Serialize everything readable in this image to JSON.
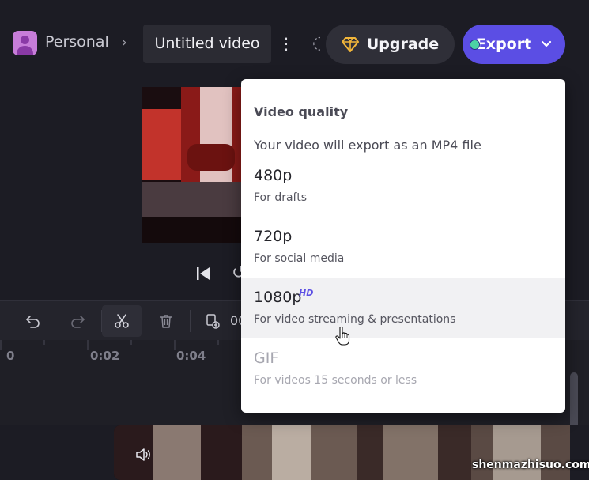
{
  "header": {
    "workspace_name": "Personal",
    "video_title": "Untitled video",
    "more_glyph": "⋮",
    "upgrade_label": "Upgrade",
    "export_label": "Export"
  },
  "timeline": {
    "time_readout_partial": "00",
    "ruler_labels": [
      "0",
      "0:02",
      "0:04"
    ]
  },
  "export_menu": {
    "heading": "Video quality",
    "subheading": "Your video will export as an MP4 file",
    "options": [
      {
        "label": "480p",
        "description": "For drafts",
        "badge": "",
        "state": "normal"
      },
      {
        "label": "720p",
        "description": "For social media",
        "badge": "",
        "state": "normal"
      },
      {
        "label": "1080p",
        "description": "For video streaming & presentations",
        "badge": "HD",
        "state": "hovered"
      },
      {
        "label": "GIF",
        "description": "For videos 15 seconds or less",
        "badge": "",
        "state": "disabled"
      }
    ]
  },
  "watermark": "shenmazhisuo.com",
  "colors": {
    "background": "#1c1c24",
    "accent": "#5b4ee4",
    "status_dot": "#4cd2a4",
    "upgrade_diamond": "#f2b63a"
  },
  "icons": {
    "workspace": "avatar-icon",
    "breadcrumb": "chevron-right-icon",
    "upgrade": "diamond-icon",
    "export_caret": "chevron-down-icon",
    "undo": "undo-icon",
    "redo": "redo-icon",
    "split": "scissors-icon",
    "delete": "trash-icon",
    "duplicate": "duplicate-icon",
    "skip_back": "skip-back-icon",
    "audio": "speaker-icon"
  }
}
